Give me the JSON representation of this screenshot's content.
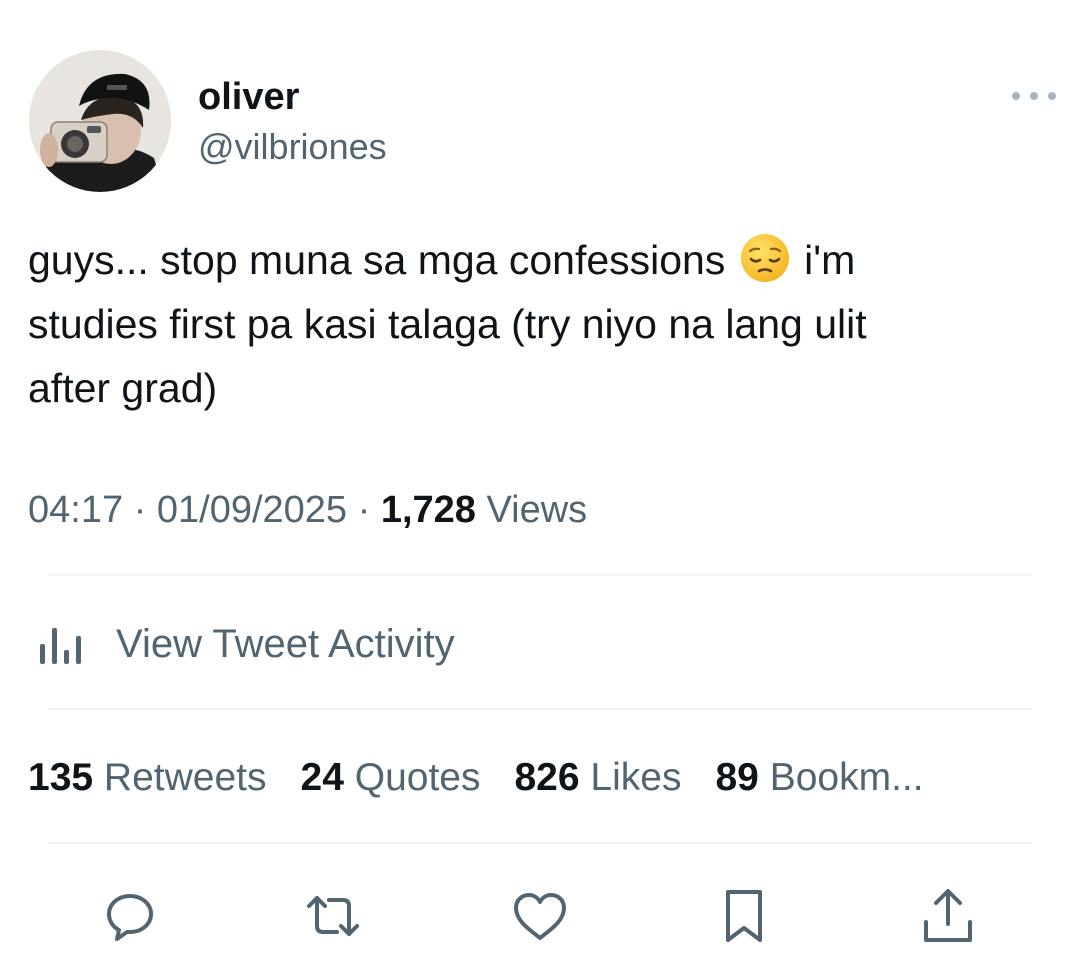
{
  "user": {
    "display_name": "oliver",
    "handle": "@vilbriones"
  },
  "tweet": {
    "text_part1": "guys... stop muna sa mga confessions ",
    "emoji": "pensive-face",
    "text_part2": " i'm\nstudies first pa kasi talaga (try niyo na lang ulit\nafter grad)"
  },
  "meta": {
    "time": "04:17",
    "separator": "·",
    "date": "01/09/2025",
    "views_count": "1,728",
    "views_label": "Views"
  },
  "activity": {
    "label": "View Tweet Activity"
  },
  "stats": [
    {
      "count": "135",
      "label": "Retweets"
    },
    {
      "count": "24",
      "label": "Quotes"
    },
    {
      "count": "826",
      "label": "Likes"
    },
    {
      "count": "89",
      "label": "Bookm..."
    }
  ],
  "colors": {
    "primary_text": "#0f1419",
    "secondary_text": "#536471",
    "divider": "#eff3f4"
  },
  "icons": [
    "more-icon",
    "analytics-icon",
    "reply-icon",
    "retweet-icon",
    "like-icon",
    "bookmark-icon",
    "share-icon"
  ]
}
